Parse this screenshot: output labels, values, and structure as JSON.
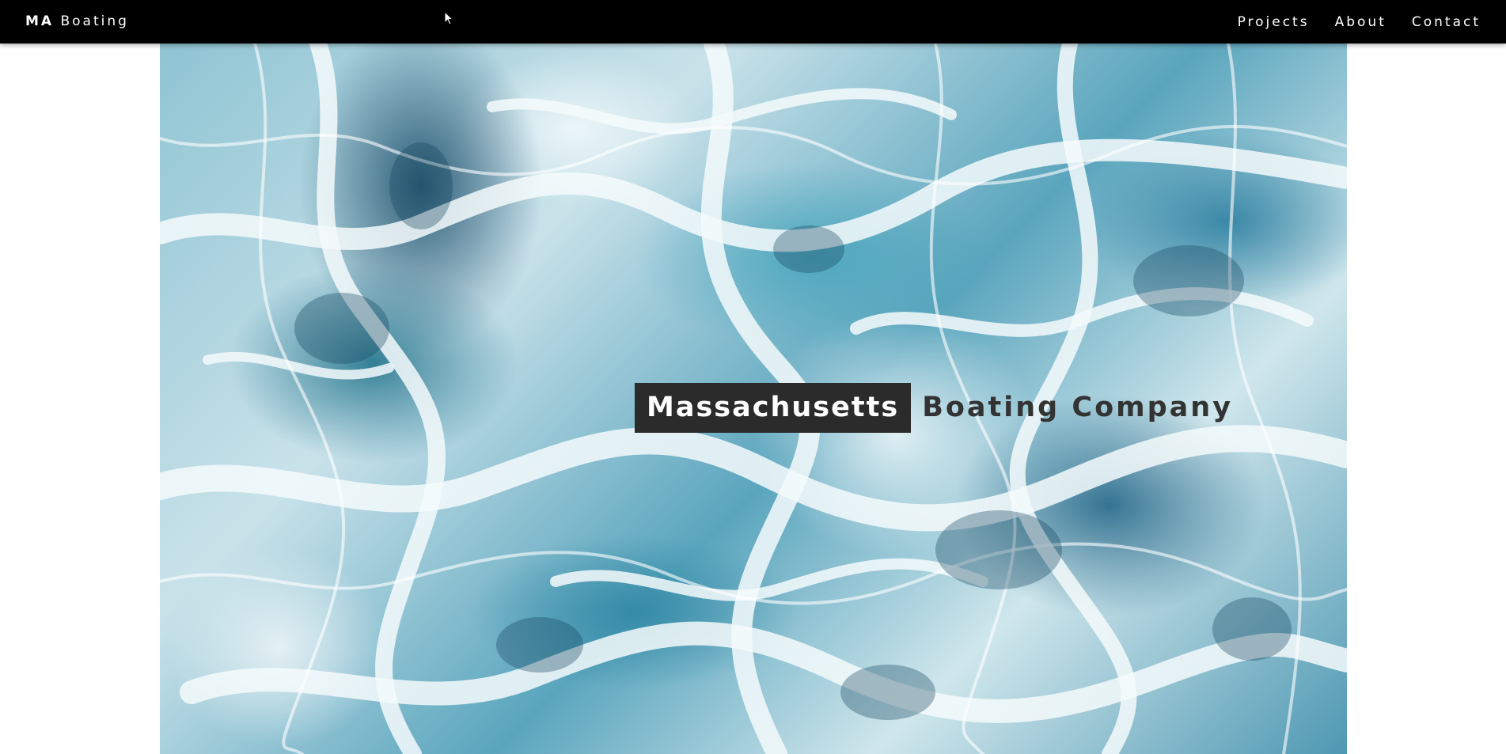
{
  "header": {
    "brand_bold": "MA",
    "brand_rest": "Boating",
    "nav": [
      {
        "label": "Projects"
      },
      {
        "label": "About"
      },
      {
        "label": "Contact"
      }
    ]
  },
  "hero": {
    "title_boxed": "Massachusetts",
    "title_rest": "Boating Company",
    "background_icon": "ocean-water-image"
  },
  "colors": {
    "topbar": "#000000",
    "nav_text": "#ffffff",
    "title_box": "#2b2b2b",
    "title_text_dark": "#333333",
    "page_background": "#ffffff"
  }
}
